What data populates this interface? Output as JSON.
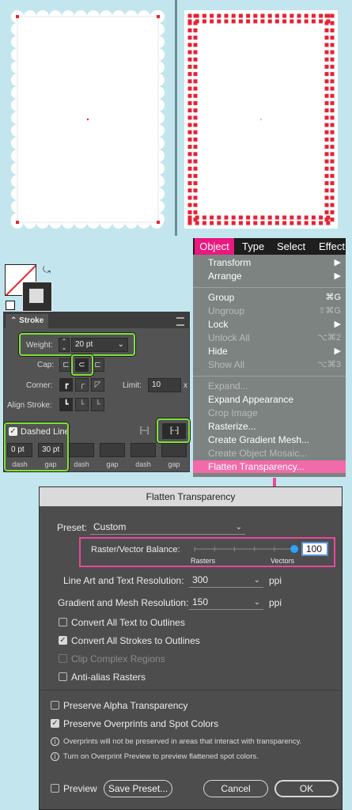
{
  "colors": {
    "accent_pink": "#e9197f",
    "highlight_green": "#7ee13b",
    "dialog_bg": "#4d4d4d",
    "scallop_red": "#e62234",
    "slider_blue": "#2ba3ff"
  },
  "stroke_panel": {
    "tab_label": "Stroke",
    "weight_label": "Weight:",
    "weight_value": "20 pt",
    "cap_label": "Cap:",
    "corner_label": "Corner:",
    "limit_label": "Limit:",
    "limit_value": "10",
    "limit_suffix": "x",
    "align_label": "Align Stroke:",
    "dashed_label": "Dashed Line",
    "dashed_checked": true,
    "dash_fields": [
      {
        "value": "0 pt",
        "caption": "dash"
      },
      {
        "value": "30 pt",
        "caption": "gap"
      },
      {
        "value": "",
        "caption": "dash"
      },
      {
        "value": "",
        "caption": "gap"
      },
      {
        "value": "",
        "caption": "dash"
      },
      {
        "value": "",
        "caption": "gap"
      }
    ]
  },
  "menubar": {
    "items": [
      "Object",
      "Type",
      "Select",
      "Effect"
    ],
    "active": "Object"
  },
  "object_menu": {
    "items": [
      {
        "label": "Transform",
        "shortcut": "▶",
        "disabled": false
      },
      {
        "label": "Arrange",
        "shortcut": "▶",
        "disabled": false
      },
      {
        "label": "Group",
        "shortcut": "⌘G",
        "disabled": false
      },
      {
        "label": "Ungroup",
        "shortcut": "⇧⌘G",
        "disabled": true
      },
      {
        "label": "Lock",
        "shortcut": "▶",
        "disabled": false
      },
      {
        "label": "Unlock All",
        "shortcut": "⌥⌘2",
        "disabled": true
      },
      {
        "label": "Hide",
        "shortcut": "▶",
        "disabled": false
      },
      {
        "label": "Show All",
        "shortcut": "⌥⌘3",
        "disabled": true
      },
      {
        "label": "Expand...",
        "shortcut": "",
        "disabled": true
      },
      {
        "label": "Expand Appearance",
        "shortcut": "",
        "disabled": false
      },
      {
        "label": "Crop Image",
        "shortcut": "",
        "disabled": true
      },
      {
        "label": "Rasterize...",
        "shortcut": "",
        "disabled": false
      },
      {
        "label": "Create Gradient Mesh...",
        "shortcut": "",
        "disabled": false
      },
      {
        "label": "Create Object Mosaic...",
        "shortcut": "",
        "disabled": true
      },
      {
        "label": "Flatten Transparency...",
        "shortcut": "",
        "disabled": false,
        "highlighted": true
      }
    ]
  },
  "flatten_dialog": {
    "title": "Flatten Transparency",
    "preset_label": "Preset:",
    "preset_value": "Custom",
    "balance_label": "Raster/Vector Balance:",
    "balance_value": "100",
    "balance_level": 100,
    "rasters_label": "Rasters",
    "vectors_label": "Vectors",
    "line_art_label": "Line Art and Text Resolution:",
    "line_art_value": "300",
    "gradient_label": "Gradient and Mesh Resolution:",
    "gradient_value": "150",
    "ppi": "ppi",
    "opt_text_outlines": "Convert All Text to Outlines",
    "opt_strokes_outlines": "Convert All Strokes to Outlines",
    "opt_clip": "Clip Complex Regions",
    "opt_antialias": "Anti-alias Rasters",
    "opt_alpha": "Preserve Alpha Transparency",
    "opt_overprints": "Preserve Overprints and Spot Colors",
    "note1": "Overprints will not be preserved in areas that interact with transparency.",
    "note2": "Turn on Overprint Preview to preview flattened spot colors.",
    "preview_label": "Preview",
    "save_preset_label": "Save Preset...",
    "cancel_label": "Cancel",
    "ok_label": "OK"
  }
}
